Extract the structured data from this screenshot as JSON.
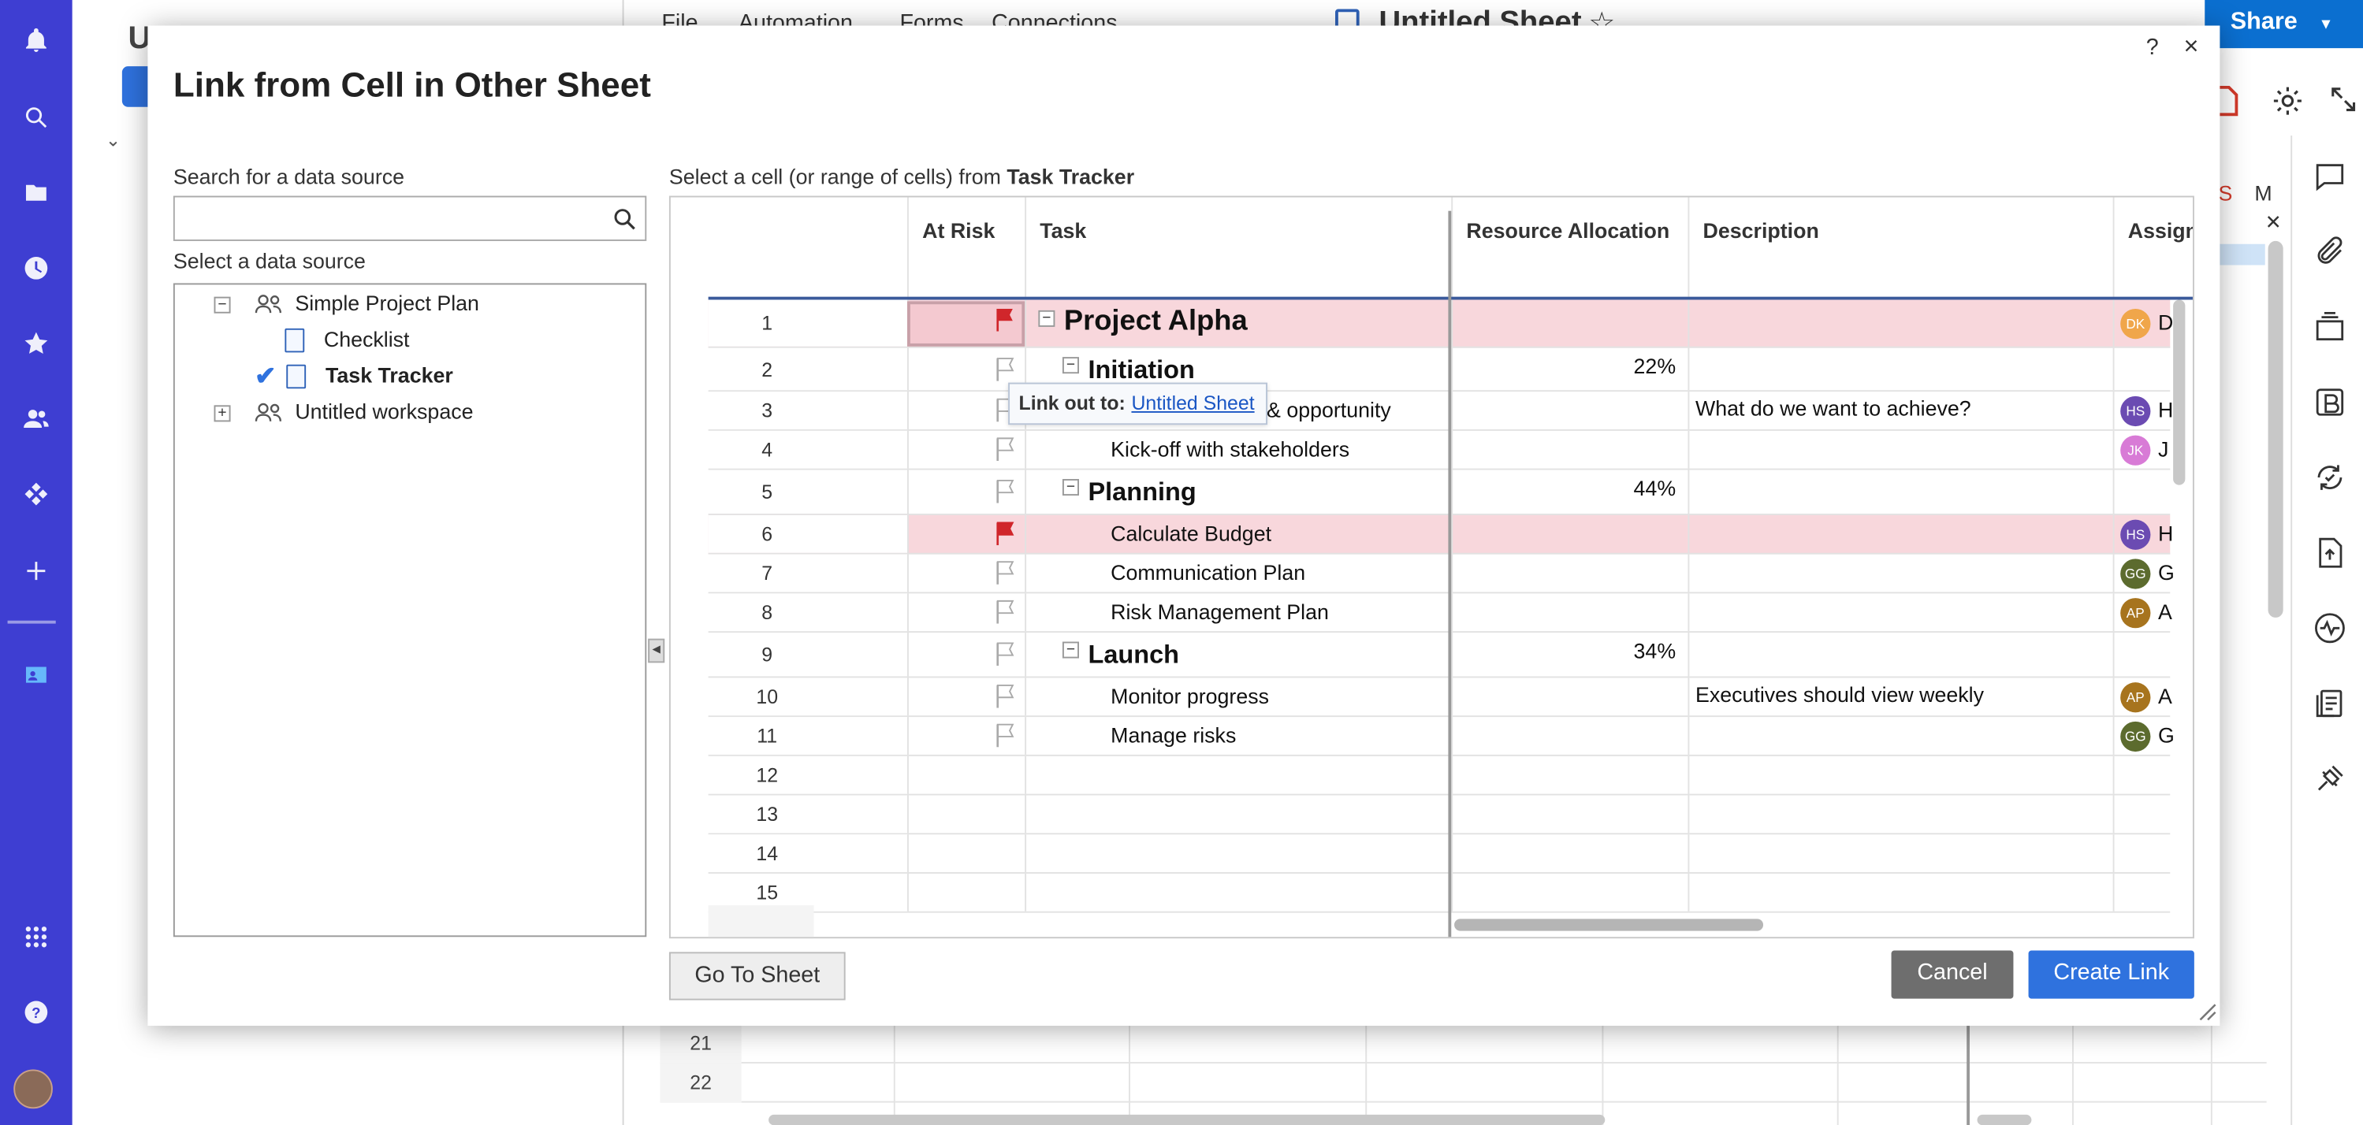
{
  "app": {
    "sheet_name": "Untitled Sheet",
    "share_label": "Share",
    "left_panel_initial": "U"
  },
  "menu": [
    "File",
    "Automation",
    "Forms",
    "Connections"
  ],
  "calendar_letters": [
    "S",
    "M"
  ],
  "dialog": {
    "title": "Link from Cell in Other Sheet",
    "help": "?",
    "close": "×",
    "search_label": "Search for a data source",
    "search_value": "",
    "select_label": "Select a data source",
    "select_cell_prefix": "Select a cell (or range of cells) from ",
    "select_cell_sheet": "Task Tracker",
    "goto_label": "Go To Sheet",
    "cancel_label": "Cancel",
    "create_label": "Create Link"
  },
  "tree": [
    {
      "label": "Simple Project Plan",
      "type": "workspace",
      "toggle": "−"
    },
    {
      "label": "Checklist",
      "type": "sheet"
    },
    {
      "label": "Task Tracker",
      "type": "sheet",
      "selected": true
    },
    {
      "label": "Untitled workspace",
      "type": "workspace",
      "toggle": "+"
    }
  ],
  "tooltip": {
    "prefix": "Link out to:",
    "link": "Untitled Sheet"
  },
  "columns": [
    "At Risk",
    "Task",
    "Resource Allocation",
    "Description",
    "Assign"
  ],
  "rows": [
    {
      "n": "1",
      "flag": true,
      "task": "Project Alpha",
      "level": 0,
      "ra": "",
      "desc": "",
      "initials": "DK",
      "name": "D",
      "color": "#f0a64a",
      "highlight": true
    },
    {
      "n": "2",
      "flag": false,
      "task": "Initiation",
      "level": 1,
      "ra": "22%",
      "desc": "",
      "initials": "",
      "name": ""
    },
    {
      "n": "3",
      "flag": false,
      "task": "Identify problem & opportunity",
      "level": 2,
      "ra": "",
      "desc": "What do we want to achieve?",
      "initials": "HS",
      "name": "H",
      "color": "#6b4bb2"
    },
    {
      "n": "4",
      "flag": false,
      "task": "Kick-off with stakeholders",
      "level": 2,
      "ra": "",
      "desc": "",
      "initials": "JK",
      "name": "J",
      "color": "#d87bd6"
    },
    {
      "n": "5",
      "flag": false,
      "task": "Planning",
      "level": 1,
      "ra": "44%",
      "desc": "",
      "initials": "",
      "name": ""
    },
    {
      "n": "6",
      "flag": true,
      "task": "Calculate Budget",
      "level": 2,
      "ra": "",
      "desc": "",
      "initials": "HS",
      "name": "H",
      "color": "#6b4bb2",
      "highlight": true
    },
    {
      "n": "7",
      "flag": false,
      "task": "Communication Plan",
      "level": 2,
      "ra": "",
      "desc": "",
      "initials": "GG",
      "name": "G",
      "color": "#5c6b2e"
    },
    {
      "n": "8",
      "flag": false,
      "task": "Risk Management Plan",
      "level": 2,
      "ra": "",
      "desc": "",
      "initials": "AP",
      "name": "A",
      "color": "#a7741e"
    },
    {
      "n": "9",
      "flag": false,
      "task": "Launch",
      "level": 1,
      "ra": "34%",
      "desc": "",
      "initials": "",
      "name": ""
    },
    {
      "n": "10",
      "flag": false,
      "task": "Monitor progress",
      "level": 2,
      "ra": "",
      "desc": "Executives should view weekly",
      "initials": "AP",
      "name": "A",
      "color": "#a7741e"
    },
    {
      "n": "11",
      "flag": false,
      "task": "Manage risks",
      "level": 2,
      "ra": "",
      "desc": "",
      "initials": "GG",
      "name": "G",
      "color": "#5c6b2e"
    },
    {
      "n": "12",
      "flag": null,
      "task": "",
      "level": 2,
      "ra": "",
      "desc": "",
      "initials": "",
      "name": ""
    },
    {
      "n": "13",
      "flag": null,
      "task": "",
      "level": 2,
      "ra": "",
      "desc": "",
      "initials": "",
      "name": ""
    },
    {
      "n": "14",
      "flag": null,
      "task": "",
      "level": 2,
      "ra": "",
      "desc": "",
      "initials": "",
      "name": ""
    },
    {
      "n": "15",
      "flag": null,
      "task": "",
      "level": 2,
      "ra": "",
      "desc": "",
      "initials": "",
      "name": ""
    }
  ],
  "background_rows": [
    "21",
    "22"
  ],
  "colors": {
    "rail": "#3e3ed2",
    "accent": "#2f72de",
    "risk_row": "#f8d7dc",
    "flag": "#d0262b",
    "share": "#0b6fd0"
  }
}
